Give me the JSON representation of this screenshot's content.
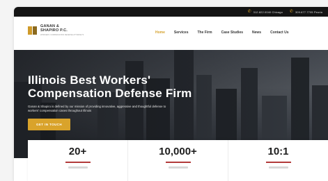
{
  "topbar": {
    "phones": [
      {
        "icon": "phone-icon",
        "text": "312.822.0040 Chicago"
      },
      {
        "icon": "phone-icon",
        "text": "309.677.7705 Peoria"
      }
    ]
  },
  "header": {
    "logo": {
      "name_line1": "GANAN &",
      "name_line2": "SHAPIRO P.C.",
      "tagline": "WORKERS' COMPENSATION DEFENSE ATTORNEYS"
    },
    "nav": [
      {
        "label": "Home",
        "active": true
      },
      {
        "label": "Services",
        "active": false
      },
      {
        "label": "The Firm",
        "active": false
      },
      {
        "label": "Case Studies",
        "active": false
      },
      {
        "label": "News",
        "active": false
      },
      {
        "label": "Contact Us",
        "active": false
      }
    ]
  },
  "hero": {
    "title_line1": "Illinois Best Workers'",
    "title_line2": "Compensation Defense Firm",
    "description": "Ganan & Shapiro is defined by our mission of providing innovative, aggressive and thoughtful defense to workers' compensation cases throughout Illinois",
    "cta_label": "GET IN TOUCH"
  },
  "stats": [
    {
      "value": "20+"
    },
    {
      "value": "10,000+"
    },
    {
      "value": "10:1"
    }
  ],
  "colors": {
    "accent": "#d9a32b",
    "topbar": "#141414",
    "stat_rule": "#b23a3a"
  }
}
